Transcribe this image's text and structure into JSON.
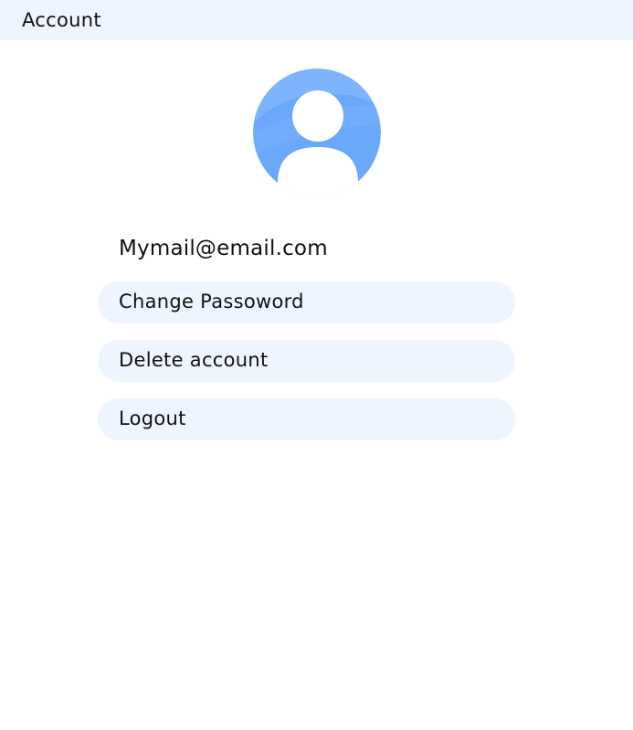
{
  "header": {
    "title": "Account"
  },
  "profile": {
    "avatar_icon": "user-avatar-icon",
    "avatar_color": "#6aa8fc",
    "email": "Mymail@email.com"
  },
  "actions": [
    {
      "label": "Change Passoword"
    },
    {
      "label": "Delete account"
    },
    {
      "label": "Logout"
    }
  ],
  "colors": {
    "header_bg": "#eff5fe",
    "button_bg": "#eff5fe",
    "text": "#111111"
  }
}
